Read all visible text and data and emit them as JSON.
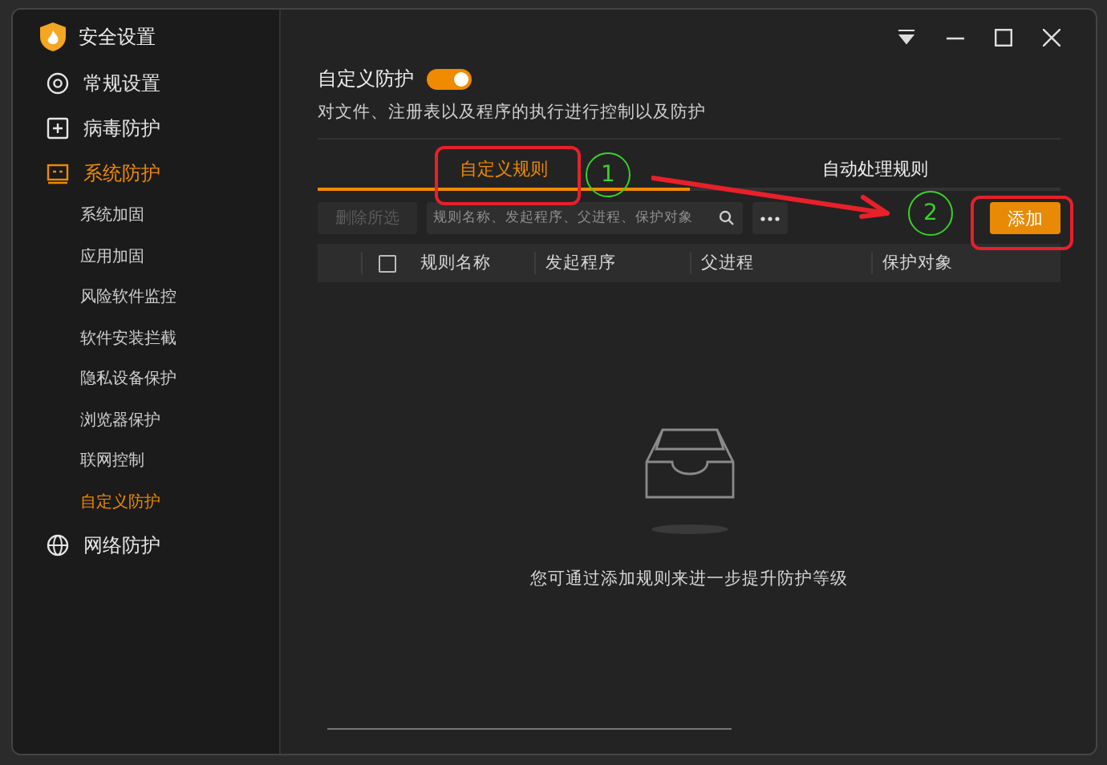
{
  "window": {
    "title": "安全设置"
  },
  "sidebar": {
    "items": [
      {
        "label": "常规设置",
        "selected": false
      },
      {
        "label": "病毒防护",
        "selected": false
      },
      {
        "label": "系统防护",
        "selected": true,
        "children": [
          {
            "label": "系统加固",
            "selected": false
          },
          {
            "label": "应用加固",
            "selected": false
          },
          {
            "label": "风险软件监控",
            "selected": false
          },
          {
            "label": "软件安装拦截",
            "selected": false
          },
          {
            "label": "隐私设备保护",
            "selected": false
          },
          {
            "label": "浏览器保护",
            "selected": false
          },
          {
            "label": "联网控制",
            "selected": false
          },
          {
            "label": "自定义防护",
            "selected": true
          }
        ]
      },
      {
        "label": "网络防护",
        "selected": false
      }
    ]
  },
  "section": {
    "title": "自定义防护",
    "toggle_on": true,
    "description": "对文件、注册表以及程序的执行进行控制以及防护"
  },
  "tabs": [
    {
      "label": "自定义规则",
      "selected": true
    },
    {
      "label": "自动处理规则",
      "selected": false
    }
  ],
  "toolbar": {
    "delete_button": {
      "label": "删除所选",
      "disabled": true
    },
    "search": {
      "placeholder": "规则名称、发起程序、父进程、保护对象"
    },
    "add_button": "添加"
  },
  "table": {
    "select_all_checked": false,
    "columns": [
      "规则名称",
      "发起程序",
      "父进程",
      "保护对象"
    ]
  },
  "empty_message": "您可通过添加规则来进一步提升防护等级",
  "annotations": {
    "markers": [
      "1",
      "2"
    ]
  }
}
